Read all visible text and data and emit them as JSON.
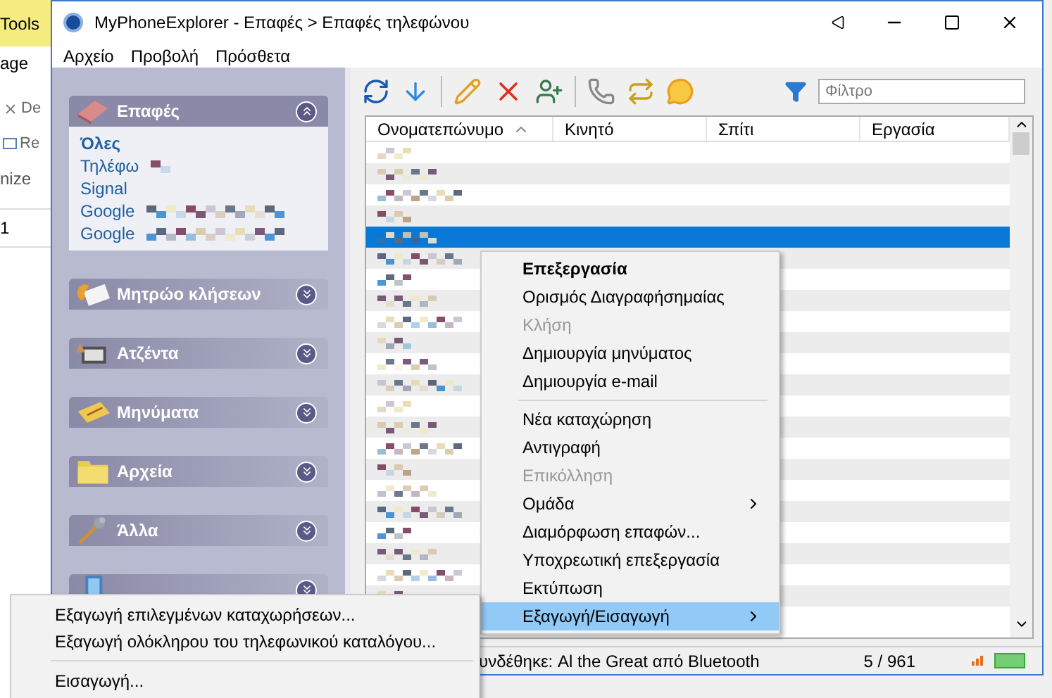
{
  "background_window": {
    "texts": [
      "Tools",
      "age",
      "De",
      "Re",
      "nize",
      "1"
    ]
  },
  "window": {
    "title": "MyPhoneExplorer -  Επαφές > Επαφές τηλεφώνου"
  },
  "menu": [
    "Αρχείο",
    "Προβολή",
    "Πρόσθετα"
  ],
  "sidebar": {
    "groups": [
      {
        "label": "Επαφές",
        "expanded": true,
        "items": [
          {
            "label": "Όλες",
            "selected": true,
            "redacted": false
          },
          {
            "label": "Τηλέφω",
            "selected": false,
            "redacted": true
          },
          {
            "label": "Signal",
            "selected": false,
            "redacted": false
          },
          {
            "label": "Google",
            "selected": false,
            "redacted": true
          },
          {
            "label": "Google",
            "selected": false,
            "redacted": true
          }
        ]
      },
      {
        "label": "Μητρώο κλήσεων",
        "expanded": false
      },
      {
        "label": "Ατζέντα",
        "expanded": false
      },
      {
        "label": "Μηνύματα",
        "expanded": false
      },
      {
        "label": "Αρχεία",
        "expanded": false
      },
      {
        "label": "Άλλα",
        "expanded": false
      },
      {
        "expanded": false
      }
    ]
  },
  "filter": {
    "placeholder": "Φίλτρο"
  },
  "table": {
    "columns": [
      {
        "label": "Ονοματεπώνυμο",
        "sorted": true
      },
      {
        "label": "Κινητό",
        "sorted": false
      },
      {
        "label": "Σπίτι",
        "sorted": false
      },
      {
        "label": "Εργασία",
        "sorted": false
      }
    ],
    "rows": [
      {
        "selected": false
      },
      {
        "selected": false
      },
      {
        "selected": false
      },
      {
        "selected": false
      },
      {
        "selected": true
      },
      {
        "selected": false
      },
      {
        "selected": false
      },
      {
        "selected": false
      },
      {
        "selected": false
      },
      {
        "selected": false
      },
      {
        "selected": false
      },
      {
        "selected": false
      },
      {
        "selected": false
      },
      {
        "selected": false
      },
      {
        "selected": false
      },
      {
        "selected": false
      },
      {
        "selected": false
      },
      {
        "selected": false
      },
      {
        "selected": false
      },
      {
        "selected": false
      },
      {
        "selected": false
      },
      {
        "selected": false
      }
    ]
  },
  "context_menu": [
    {
      "kind": "item",
      "label": "Επεξεργασία",
      "bold": true,
      "disabled": false,
      "submenu": false,
      "selected": false
    },
    {
      "kind": "item",
      "label": "Ορισμός Διαγραφήσημαίας",
      "bold": false,
      "disabled": false,
      "submenu": false,
      "selected": false
    },
    {
      "kind": "item",
      "label": "Κλήση",
      "bold": false,
      "disabled": true,
      "submenu": false,
      "selected": false
    },
    {
      "kind": "item",
      "label": "Δημιουργία μηνύματος",
      "bold": false,
      "disabled": false,
      "submenu": false,
      "selected": false
    },
    {
      "kind": "item",
      "label": "Δημιουργία e-mail",
      "bold": false,
      "disabled": false,
      "submenu": false,
      "selected": false
    },
    {
      "kind": "separator"
    },
    {
      "kind": "item",
      "label": "Νέα καταχώρηση",
      "bold": false,
      "disabled": false,
      "submenu": false,
      "selected": false
    },
    {
      "kind": "item",
      "label": "Αντιγραφή",
      "bold": false,
      "disabled": false,
      "submenu": false,
      "selected": false
    },
    {
      "kind": "item",
      "label": "Επικόλληση",
      "bold": false,
      "disabled": true,
      "submenu": false,
      "selected": false
    },
    {
      "kind": "item",
      "label": "Ομάδα",
      "bold": false,
      "disabled": false,
      "submenu": true,
      "selected": false
    },
    {
      "kind": "item",
      "label": "Διαμόρφωση επαφών...",
      "bold": false,
      "disabled": false,
      "submenu": false,
      "selected": false
    },
    {
      "kind": "item",
      "label": "Υποχρεωτική επεξεργασία",
      "bold": false,
      "disabled": false,
      "submenu": false,
      "selected": false
    },
    {
      "kind": "item",
      "label": "Εκτύπωση",
      "bold": false,
      "disabled": false,
      "submenu": false,
      "selected": false
    },
    {
      "kind": "item",
      "label": "Εξαγωγή/Εισαγωγή",
      "bold": false,
      "disabled": false,
      "submenu": true,
      "selected": true
    }
  ],
  "submenu": [
    {
      "kind": "item",
      "label": "Εξαγωγή επιλεγμένων καταχωρήσεων..."
    },
    {
      "kind": "item",
      "label": "Εξαγωγή ολόκληρου του τηλεφωνικού καταλόγου..."
    },
    {
      "kind": "separator"
    },
    {
      "kind": "item",
      "label": "Εισαγωγή..."
    }
  ],
  "status_bar": {
    "text": "υνδέθηκε:  Al the Great από Bluetooth",
    "count": "5 / 961"
  }
}
